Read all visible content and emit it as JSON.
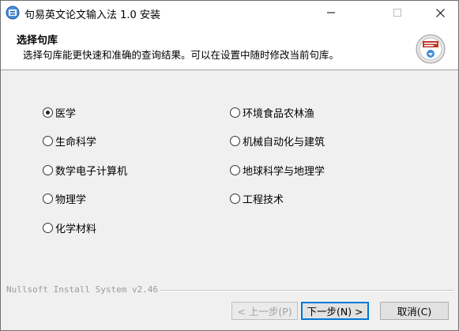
{
  "window": {
    "title": "句易英文论文输入法 1.0 安装",
    "minimize_icon": "minimize-icon",
    "maximize_icon": "maximize-icon",
    "close_icon": "close-icon"
  },
  "header": {
    "title": "选择句库",
    "subtitle": "选择句库能更快速和准确的查询结果。可以在设置中随时修改当前句库。"
  },
  "options": {
    "left": [
      {
        "label": "医学",
        "checked": true
      },
      {
        "label": "生命科学",
        "checked": false
      },
      {
        "label": "数学电子计算机",
        "checked": false
      },
      {
        "label": "物理学",
        "checked": false
      },
      {
        "label": "化学材料",
        "checked": false
      }
    ],
    "right": [
      {
        "label": "环境食品农林渔",
        "checked": false
      },
      {
        "label": "机械自动化与建筑",
        "checked": false
      },
      {
        "label": "地球科学与地理学",
        "checked": false
      },
      {
        "label": "工程技术",
        "checked": false
      }
    ]
  },
  "footer": {
    "brand": "Nullsoft Install System v2.46",
    "back_label": "< 上一步(P)",
    "next_label": "下一步(N) >",
    "cancel_label": "取消(C)"
  },
  "colors": {
    "focus_border": "#0078d7",
    "background": "#f0f0f0"
  }
}
